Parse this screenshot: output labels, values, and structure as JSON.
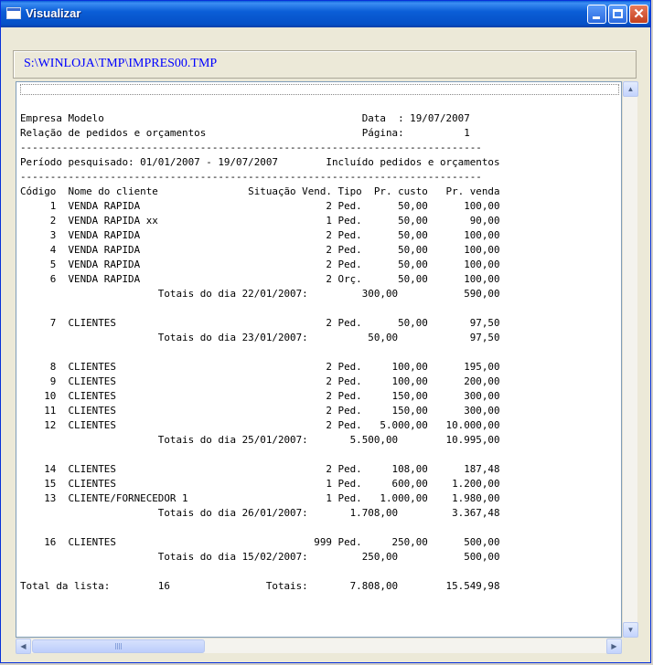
{
  "window": {
    "title": "Visualizar"
  },
  "controls": {
    "minimize": "_",
    "maximize": "□",
    "close": "✕"
  },
  "path": "S:\\WINLOJA\\TMP\\IMPRES00.TMP",
  "report": {
    "text": "Empresa Modelo                                           Data  : 19/07/2007\nRelação de pedidos e orçamentos                          Página:          1\n-----------------------------------------------------------------------------\nPeríodo pesquisado: 01/01/2007 - 19/07/2007        Incluído pedidos e orçamentos\n-----------------------------------------------------------------------------\nCódigo  Nome do cliente               Situação Vend. Tipo  Pr. custo   Pr. venda\n     1  VENDA RAPIDA                               2 Ped.      50,00      100,00\n     2  VENDA RAPIDA xx                            1 Ped.      50,00       90,00\n     3  VENDA RAPIDA                               2 Ped.      50,00      100,00\n     4  VENDA RAPIDA                               2 Ped.      50,00      100,00\n     5  VENDA RAPIDA                               2 Ped.      50,00      100,00\n     6  VENDA RAPIDA                               2 Orç.      50,00      100,00\n                       Totais do dia 22/01/2007:         300,00           590,00\n\n     7  CLIENTES                                   2 Ped.      50,00       97,50\n                       Totais do dia 23/01/2007:          50,00            97,50\n\n     8  CLIENTES                                   2 Ped.     100,00      195,00\n     9  CLIENTES                                   2 Ped.     100,00      200,00\n    10  CLIENTES                                   2 Ped.     150,00      300,00\n    11  CLIENTES                                   2 Ped.     150,00      300,00\n    12  CLIENTES                                   2 Ped.   5.000,00   10.000,00\n                       Totais do dia 25/01/2007:       5.500,00        10.995,00\n\n    14  CLIENTES                                   2 Ped.     108,00      187,48\n    15  CLIENTES                                   1 Ped.     600,00    1.200,00\n    13  CLIENTE/FORNECEDOR 1                       1 Ped.   1.000,00    1.980,00\n                       Totais do dia 26/01/2007:       1.708,00         3.367,48\n\n    16  CLIENTES                                 999 Ped.     250,00      500,00\n                       Totais do dia 15/02/2007:         250,00           500,00\n\nTotal da lista:        16                Totais:       7.808,00        15.549,98"
  },
  "scrollbars": {
    "up_arrow": "▲",
    "down_arrow": "▼",
    "left_arrow": "◀",
    "right_arrow": "▶"
  }
}
